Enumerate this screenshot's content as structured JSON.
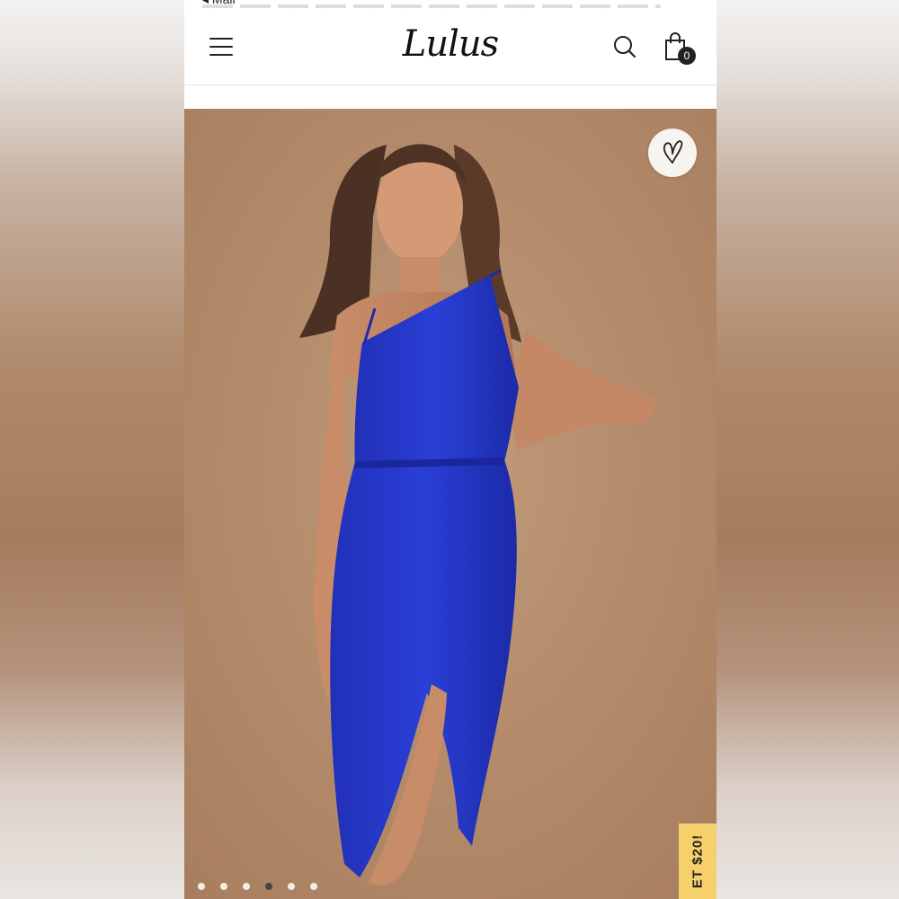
{
  "status_bar": {
    "back_label": "◂ Mail"
  },
  "header": {
    "brand": "Lulus",
    "cart_count": "0"
  },
  "product_gallery": {
    "promo_text": "ET $20!",
    "slide_count": 6,
    "active_slide": 4,
    "colors": {
      "background": "#b48c6b",
      "dress": "#2637c9",
      "promo": "#f6d06a"
    }
  },
  "icons": [
    "menu-icon",
    "search-icon",
    "shopping-bag-icon",
    "heart-icon"
  ]
}
